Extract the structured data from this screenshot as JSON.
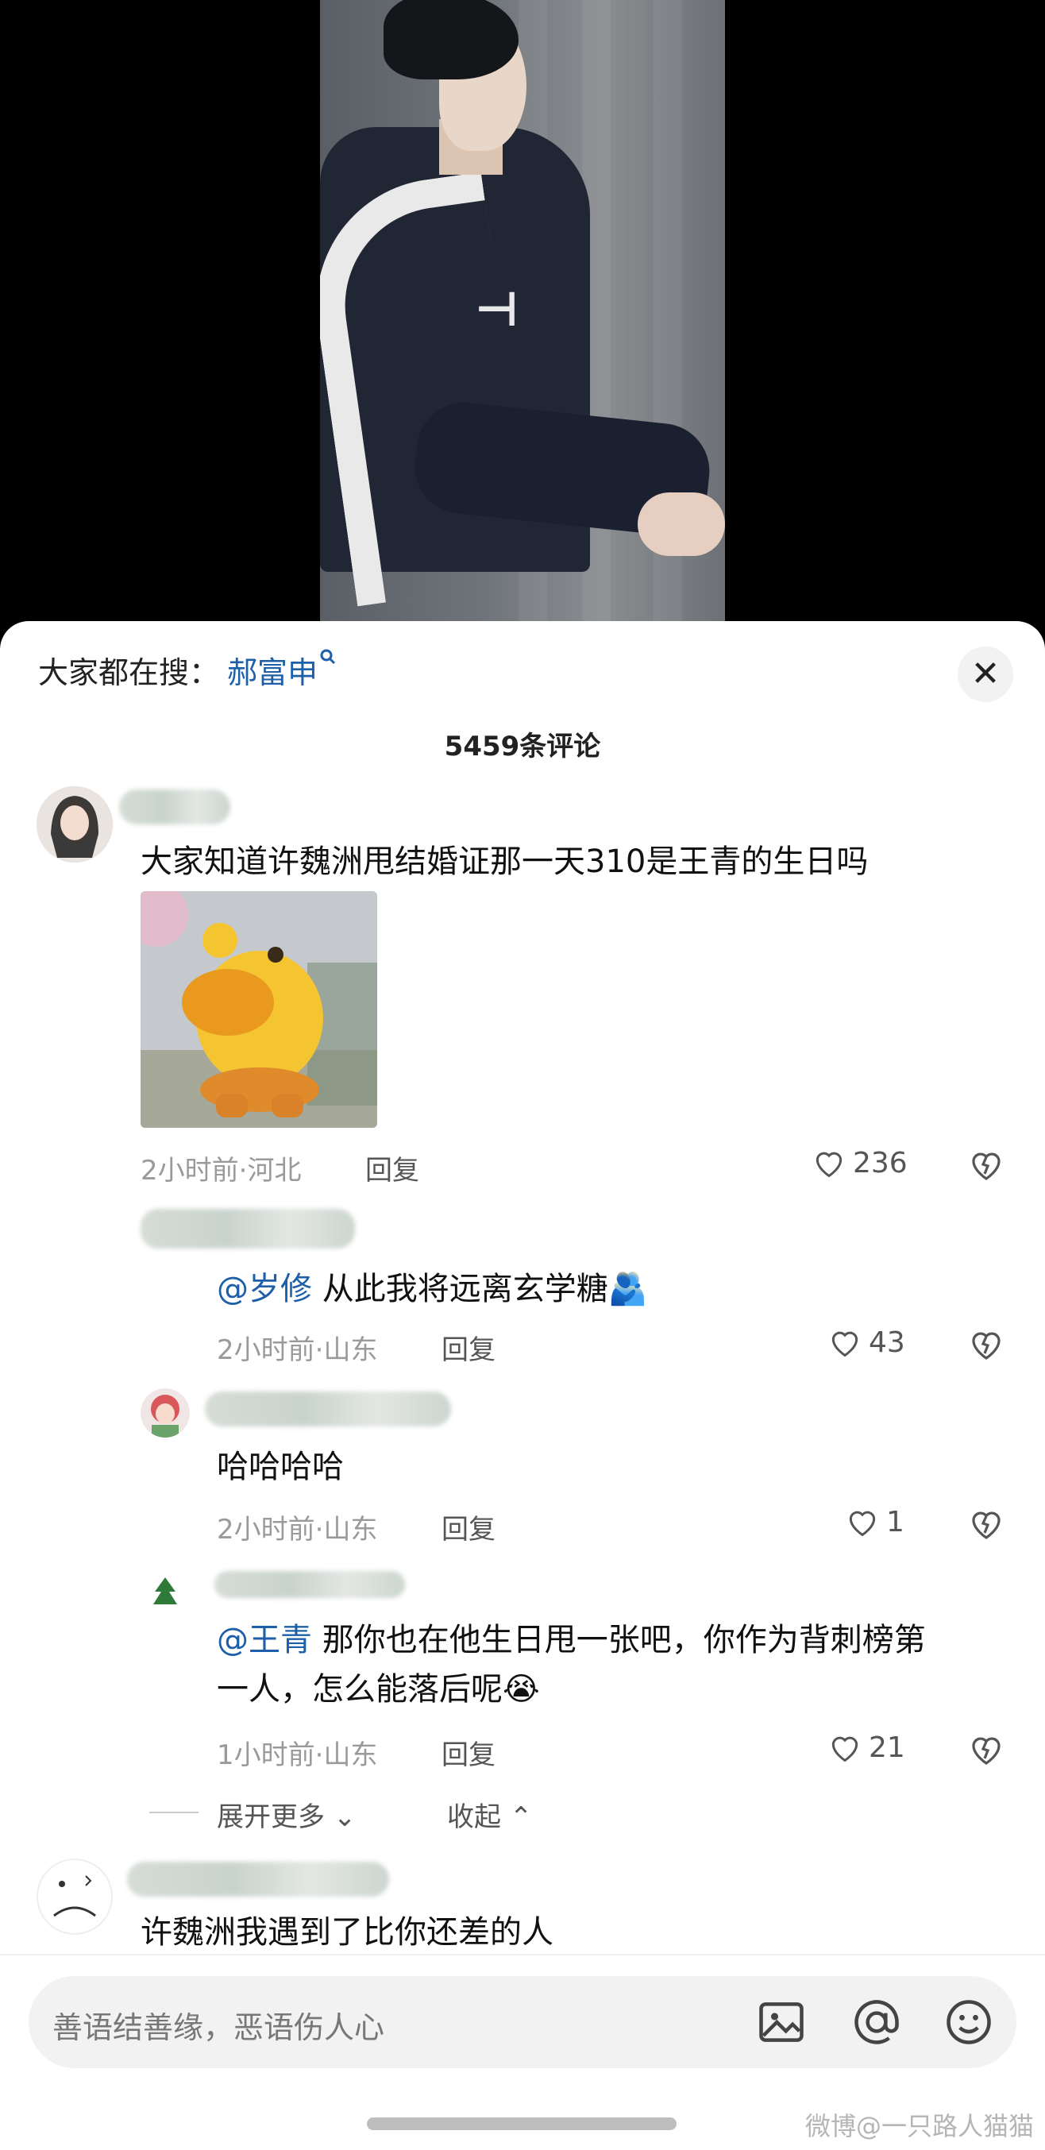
{
  "search": {
    "prefix": "大家都在搜：",
    "term": "郝富申",
    "close": "✕"
  },
  "comment_count": "5459条评论",
  "comments": [
    {
      "text": "大家知道许魏洲甩结婚证那一天310是王青的生日吗",
      "meta": "2小时前·河北",
      "reply": "回复",
      "likes": "236"
    }
  ],
  "replies": [
    {
      "mention": "@岁修",
      "text": " 从此我将远离玄学糖",
      "emoji": "🫂",
      "meta": "2小时前·山东",
      "reply": "回复",
      "likes": "43"
    },
    {
      "text": "哈哈哈哈",
      "meta": "2小时前·山东",
      "reply": "回复",
      "likes": "1"
    },
    {
      "mention": "@王青",
      "text": " 那你也在他生日甩一张吧，你作为背刺榜第",
      "text2": "一人，怎么能落后呢",
      "emoji": "😭",
      "meta": "1小时前·山东",
      "reply": "回复",
      "likes": "21"
    }
  ],
  "expand": {
    "more": "展开更多",
    "collapse": "收起"
  },
  "last_comment": {
    "text": "许魏洲我遇到了比你还差的人"
  },
  "input": {
    "placeholder": "善语结善缘，恶语伤人心"
  },
  "watermark": "微博@一只路人猫猫",
  "colors": {
    "link": "#1d5fa8",
    "sheet_bg": "#ffffff",
    "video_bg": "#000000"
  }
}
